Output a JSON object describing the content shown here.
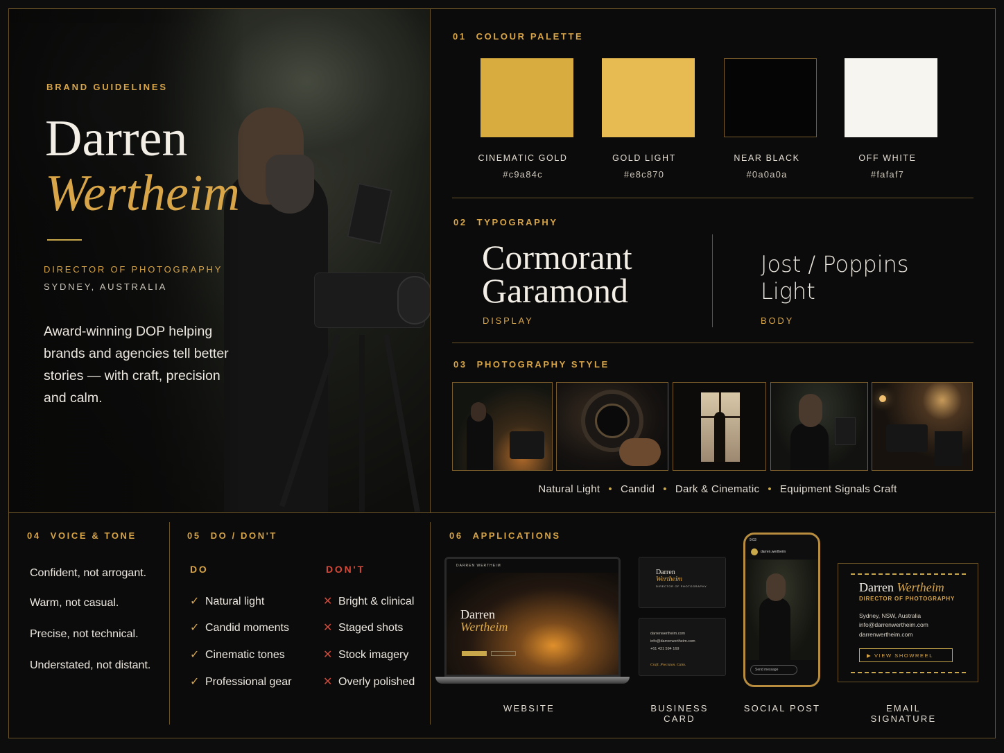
{
  "hero": {
    "eyebrow": "BRAND GUIDELINES",
    "first_name": "Darren",
    "last_name": "Wertheim",
    "role": "DIRECTOR OF PHOTOGRAPHY",
    "location": "SYDNEY, AUSTRALIA",
    "bio": "Award-winning DOP helping brands and agencies tell better stories — with craft, precision and calm."
  },
  "palette": {
    "num": "01",
    "title": "COLOUR PALETTE",
    "swatches": [
      {
        "name": "CINEMATIC GOLD",
        "hex": "#c9a84c",
        "color": "#d9ac40"
      },
      {
        "name": "GOLD LIGHT",
        "hex": "#e8c870",
        "color": "#e8bb52"
      },
      {
        "name": "NEAR BLACK",
        "hex": "#0a0a0a",
        "color": "#050505"
      },
      {
        "name": "OFF WHITE",
        "hex": "#fafaf7",
        "color": "#f6f5ef"
      }
    ]
  },
  "typography": {
    "num": "02",
    "title": "TYPOGRAPHY",
    "display_font_line1": "Cormorant",
    "display_font_line2": "Garamond",
    "display_role": "DISPLAY",
    "body_font_line1": "Jost / Poppins",
    "body_font_line2": "Light",
    "body_role": "BODY"
  },
  "photography": {
    "num": "03",
    "title": "PHOTOGRAPHY STYLE",
    "tags": [
      "Natural Light",
      "Candid",
      "Dark & Cinematic",
      "Equipment Signals Craft"
    ]
  },
  "voice": {
    "num": "04",
    "title": "VOICE & TONE",
    "items": [
      "Confident, not arrogant.",
      "Warm, not casual.",
      "Precise, not technical.",
      "Understated, not distant."
    ]
  },
  "dodont": {
    "num": "05",
    "title": "DO / DON'T",
    "do_label": "DO",
    "dont_label": "DON'T",
    "do_items": [
      "Natural light",
      "Candid moments",
      "Cinematic tones",
      "Professional gear"
    ],
    "dont_items": [
      "Bright & clinical",
      "Staged shots",
      "Stock imagery",
      "Overly polished"
    ],
    "check": "✓",
    "cross": "✕"
  },
  "applications": {
    "num": "06",
    "title": "APPLICATIONS",
    "labels": [
      "WEBSITE",
      "BUSINESS CARD",
      "SOCIAL POST",
      "EMAIL SIGNATURE"
    ],
    "website": {
      "nav_brand": "DARREN WERTHEIM",
      "name1": "Darren",
      "name2": "Wertheim"
    },
    "business_card": {
      "name1": "Darren",
      "name2": "Wertheim",
      "role": "DIRECTOR OF PHOTOGRAPHY",
      "line1": "darrenwertheim.com",
      "line2": "info@darrenwertheim.com",
      "line3": "+61 431 594 169",
      "tagline": "Craft. Precision. Calm."
    },
    "social": {
      "time": "9:03",
      "handle": "darren.wertheim",
      "message_placeholder": "Send message"
    },
    "email_signature": {
      "first": "Darren",
      "last": "Wertheim",
      "role": "DIRECTOR OF PHOTOGRAPHY",
      "location": "Sydney, NSW, Australia",
      "email": "info@darrenwertheim.com",
      "web": "darrenwertheim.com",
      "button": "▶  VIEW SHOWREEL"
    }
  }
}
